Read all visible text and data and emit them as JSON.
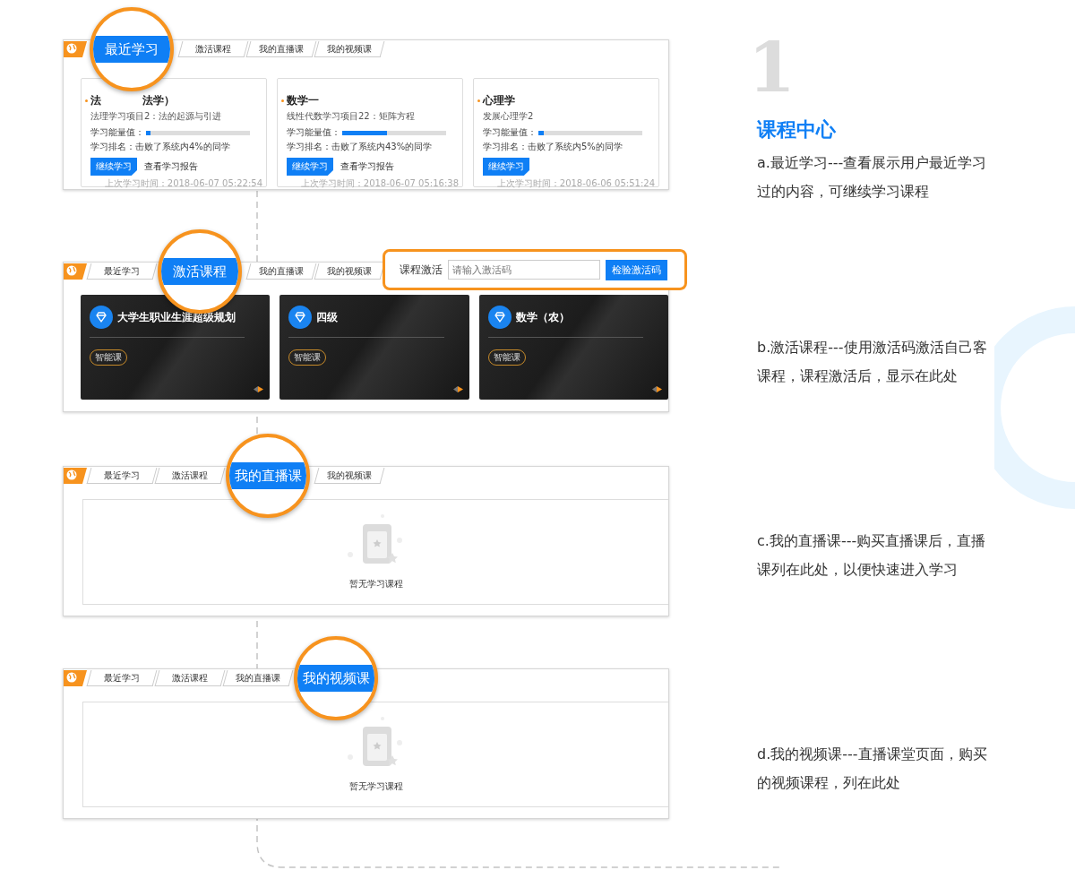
{
  "step_number": "1",
  "section_title": "课程中心",
  "panels": [
    {
      "kind": "recent",
      "tabs": [
        {
          "label": "最近学习",
          "selected": true
        },
        {
          "label": "激活课程",
          "selected": false
        },
        {
          "label": "我的直播课",
          "selected": false
        },
        {
          "label": "我的视频课",
          "selected": false
        }
      ],
      "cards": [
        {
          "title_parts": [
            "法",
            "法学）"
          ],
          "subtitle": "法理学习项目2：法的起源与引进",
          "energy_label": "学习能量值：",
          "level": 0.04,
          "rank": "学习排名：击败了系统内4%的同学",
          "continue_button": "继续学习",
          "report_link": "查看学习报告",
          "last_time": "上次学习时间：2018-06-07 05:22:54"
        },
        {
          "title_parts": [
            "数学一"
          ],
          "subtitle": "线性代数学习项目22：矩阵方程",
          "energy_label": "学习能量值：",
          "level": 0.43,
          "rank": "学习排名：击败了系统内43%的同学",
          "continue_button": "继续学习",
          "report_link": "查看学习报告",
          "last_time": "上次学习时间：2018-06-07 05:16:38"
        },
        {
          "title_parts": [
            "心理学"
          ],
          "subtitle": "发展心理学2",
          "energy_label": "学习能量值：",
          "level": 0.05,
          "rank": "学习排名：击败了系统内5%的同学",
          "continue_button": "继续学习",
          "last_time": "上次学习时间：2018-06-06 05:51:24"
        }
      ],
      "description": "a.最近学习---查看展示用户最近学习过的内容，可继续学习课程"
    },
    {
      "kind": "activated",
      "tabs": [
        {
          "label": "最近学习",
          "selected": false
        },
        {
          "label": "激活课程",
          "selected": true
        },
        {
          "label": "我的直播课",
          "selected": false
        },
        {
          "label": "我的视频课",
          "selected": false
        }
      ],
      "activation": {
        "label": "课程激活",
        "placeholder": "请输入激活码",
        "button": "检验激活码"
      },
      "cards": [
        {
          "title": "大学生职业生涯超级规划",
          "tag": "智能课"
        },
        {
          "title": "四级",
          "tag": "智能课"
        },
        {
          "title": "数学（农）",
          "tag": "智能课"
        }
      ],
      "description": "b.激活课程---使用激活码激活自己客课程，课程激活后，显示在此处"
    },
    {
      "kind": "empty",
      "tabs": [
        {
          "label": "最近学习",
          "selected": false
        },
        {
          "label": "激活课程",
          "selected": false
        },
        {
          "label": "我的直播课",
          "selected": true
        },
        {
          "label": "我的视频课",
          "selected": false
        }
      ],
      "empty_text": "暂无学习课程",
      "description": "c.我的直播课---购买直播课后，直播课列在此处，以便快速进入学习"
    },
    {
      "kind": "empty",
      "tabs": [
        {
          "label": "最近学习",
          "selected": false
        },
        {
          "label": "激活课程",
          "selected": false
        },
        {
          "label": "我的直播课",
          "selected": false
        },
        {
          "label": "我的视频课",
          "selected": true
        }
      ],
      "empty_text": "暂无学习课程",
      "description": "d.我的视频课---直播课堂页面，购买的视频课程，列在此处"
    }
  ]
}
